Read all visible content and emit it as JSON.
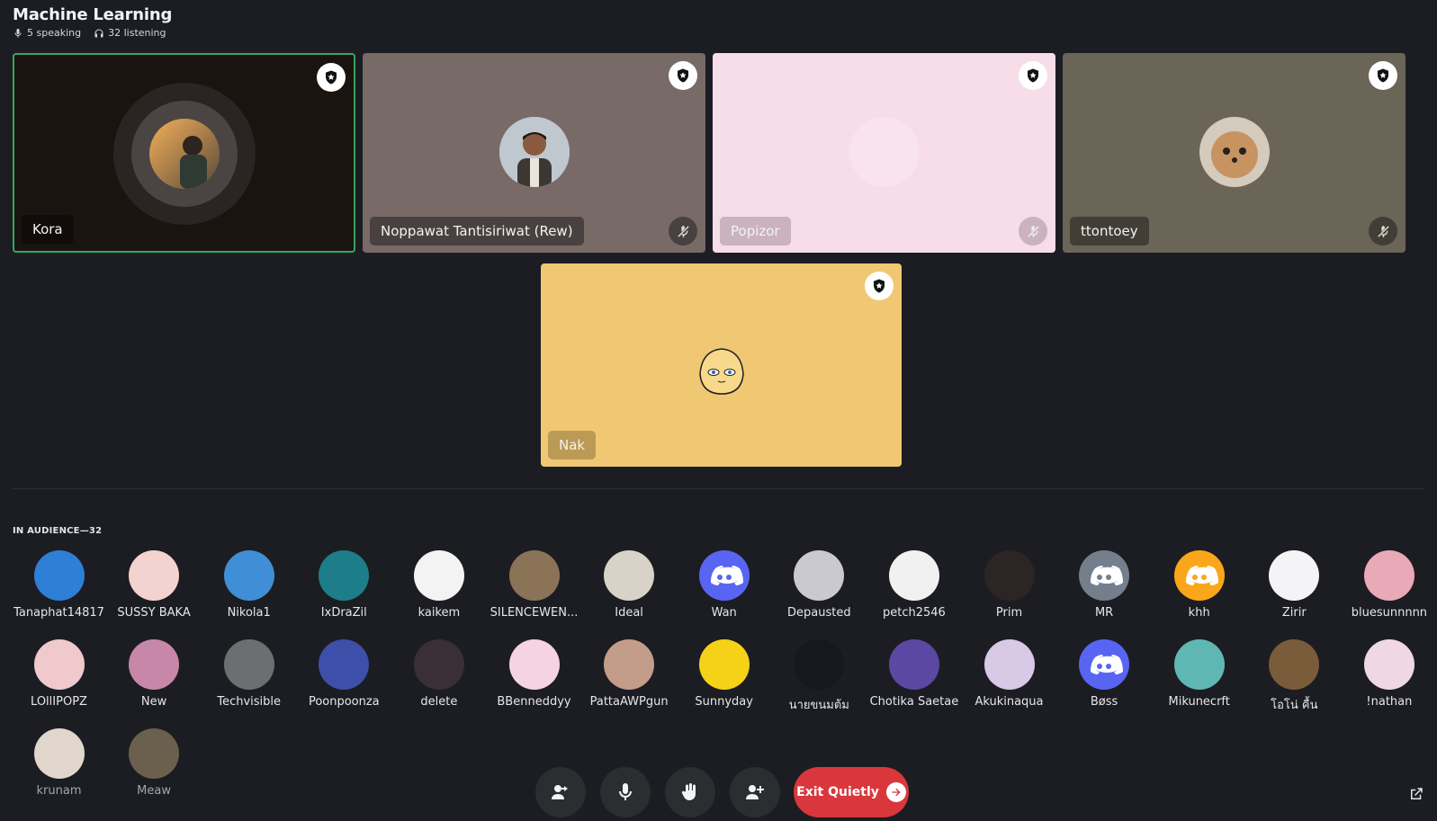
{
  "header": {
    "title": "Machine Learning",
    "speaking": "5 speaking",
    "listening": "32 listening"
  },
  "speakers": [
    {
      "name": "Kora",
      "bg": "#1a1411",
      "speaking": true,
      "muted": false
    },
    {
      "name": "Noppawat Tantisiriwat (Rew)",
      "bg": "#776a67",
      "speaking": false,
      "muted": true
    },
    {
      "name": "Popizor",
      "bg": "#f6dde8",
      "speaking": false,
      "muted": true
    },
    {
      "name": "ttontoey",
      "bg": "#6b6558",
      "speaking": false,
      "muted": true
    },
    {
      "name": "Nak",
      "bg": "#f0c874",
      "speaking": false,
      "muted": false
    }
  ],
  "audience": {
    "label": "IN AUDIENCE—32",
    "members": [
      {
        "name": "Tanaphat14817",
        "color": "#2f7fd6"
      },
      {
        "name": "SUSSY BAKA",
        "color": "#f4d2cf"
      },
      {
        "name": "Nikola1",
        "color": "#3f8ed6"
      },
      {
        "name": "IxDraZil",
        "color": "#1d7e8a"
      },
      {
        "name": "kaikem",
        "color": "#f3f3f3"
      },
      {
        "name": "SILENCEWEN...",
        "color": "#8a7356"
      },
      {
        "name": "Ideal",
        "color": "#d8d2c8"
      },
      {
        "name": "Wan",
        "color": "#5865f2"
      },
      {
        "name": "Depausted",
        "color": "#c9c9cf"
      },
      {
        "name": "petch2546",
        "color": "#f1f1f1"
      },
      {
        "name": "Prim",
        "color": "#2c2523"
      },
      {
        "name": "MR",
        "color": "#747f8d"
      },
      {
        "name": "khh",
        "color": "#faa61a"
      },
      {
        "name": "Zirir",
        "color": "#f4f4f6"
      },
      {
        "name": "bluesunnnnn",
        "color": "#e9a9b6"
      },
      {
        "name": "LOllIPOPZ",
        "color": "#efc9cc"
      },
      {
        "name": "New",
        "color": "#c787a8"
      },
      {
        "name": "Techvisible",
        "color": "#6d6e70"
      },
      {
        "name": "Poonpoonza",
        "color": "#3c4fa9"
      },
      {
        "name": "delete",
        "color": "#3a2f35"
      },
      {
        "name": "BBenneddyy",
        "color": "#f5d3e1"
      },
      {
        "name": "PattaAWPgun",
        "color": "#c49c8a"
      },
      {
        "name": "Sunnyday",
        "color": "#f5d217"
      },
      {
        "name": "นายขนมต้ม",
        "color": "#15181c"
      },
      {
        "name": "Chotika Saetae",
        "color": "#5a48a2"
      },
      {
        "name": "Akukinaqua",
        "color": "#d8c9e6"
      },
      {
        "name": "Bøss",
        "color": "#5865f2"
      },
      {
        "name": "Mikunecrft",
        "color": "#5fb7b4"
      },
      {
        "name": "โอโน่ คื้น",
        "color": "#7a5b3a"
      },
      {
        "name": "!nathan",
        "color": "#f0d7e4"
      },
      {
        "name": "krunam",
        "color": "#e0d6cc"
      },
      {
        "name": "Meaw",
        "color": "#6b5f4e"
      }
    ]
  },
  "controls": {
    "exit_label": "Exit Quietly"
  },
  "colors": {
    "speaking_ring": "#3aa55d",
    "exit": "#da373c",
    "blurple": "#5865f2"
  }
}
